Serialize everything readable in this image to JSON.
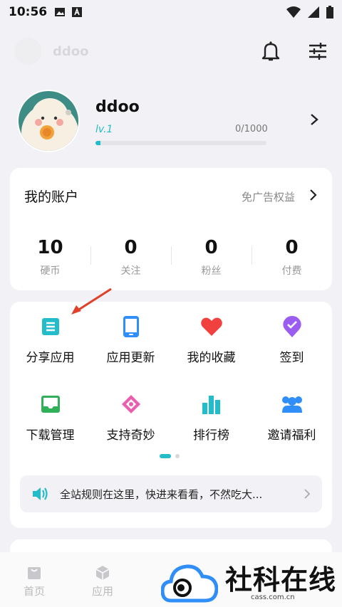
{
  "status_bar": {
    "time": "10:56"
  },
  "topbar": {
    "faded_name": "ddoo"
  },
  "profile": {
    "username": "ddoo",
    "level": "lv.1",
    "exp_text": "0/1000",
    "exp_progress": 0.03
  },
  "account": {
    "title": "我的账户",
    "rights_label": "免广告权益",
    "stats": [
      {
        "value": "10",
        "label": "硬币"
      },
      {
        "value": "0",
        "label": "关注"
      },
      {
        "value": "0",
        "label": "粉丝"
      },
      {
        "value": "0",
        "label": "付费"
      }
    ]
  },
  "menu": {
    "items": [
      {
        "label": "分享应用",
        "icon": "share-doc-icon",
        "color": "#23bccb"
      },
      {
        "label": "应用更新",
        "icon": "phone-icon",
        "color": "#2f8ef7"
      },
      {
        "label": "我的收藏",
        "icon": "heart-icon",
        "color": "#f0413e"
      },
      {
        "label": "签到",
        "icon": "checkin-badge-icon",
        "color": "#9b5cf0"
      },
      {
        "label": "下载管理",
        "icon": "download-tray-icon",
        "color": "#30b058"
      },
      {
        "label": "支持奇妙",
        "icon": "support-gift-icon",
        "color": "#e85fb0"
      },
      {
        "label": "排行榜",
        "icon": "ranking-bars-icon",
        "color": "#23bccb"
      },
      {
        "label": "邀请福利",
        "icon": "invite-users-icon",
        "color": "#2f8ef7"
      }
    ],
    "notice": "全站规则在这里，快进来看看，不然吃大..."
  },
  "bottom_nav": [
    {
      "label": "首页",
      "icon": "home-icon"
    },
    {
      "label": "应用",
      "icon": "apps-cube-icon"
    }
  ],
  "watermark": {
    "title": "社科在线",
    "sub": "cass.com.cn"
  },
  "colors": {
    "accent": "#23bccb",
    "annotation_arrow": "#e0412b"
  }
}
